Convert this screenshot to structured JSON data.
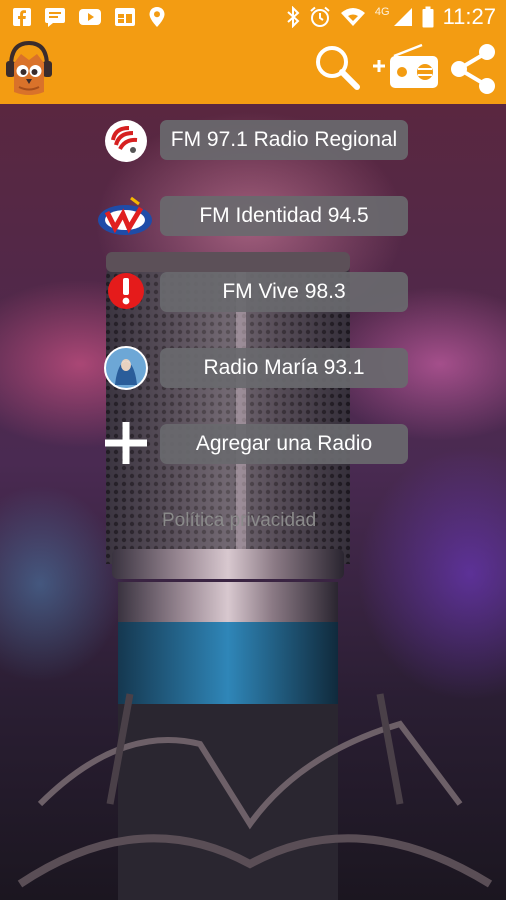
{
  "status_bar": {
    "left_icons": [
      "facebook-icon",
      "message-icon",
      "youtube-icon",
      "calendar-icon",
      "location-pin-icon"
    ],
    "right_icons": [
      "bluetooth-icon",
      "alarm-icon",
      "wifi-icon",
      "signal-icon",
      "battery-icon"
    ],
    "network": "4G",
    "time": "11:27"
  },
  "app_bar": {
    "color": "#f39c12",
    "actions": [
      "search-icon",
      "add-radio-icon",
      "share-icon"
    ]
  },
  "stations": [
    {
      "label": "FM 97.1 Radio Regional",
      "icon": "radio-regional-logo"
    },
    {
      "label": "FM Identidad 94.5",
      "icon": "identidad-logo"
    },
    {
      "label": "FM Vive 98.3",
      "icon": "vive-exclamation-logo"
    },
    {
      "label": "Radio María 93.1",
      "icon": "radio-maria-logo"
    }
  ],
  "add_radio": {
    "label": "Agregar una Radio",
    "icon": "plus-icon"
  },
  "privacy_link": "Política privacidad"
}
